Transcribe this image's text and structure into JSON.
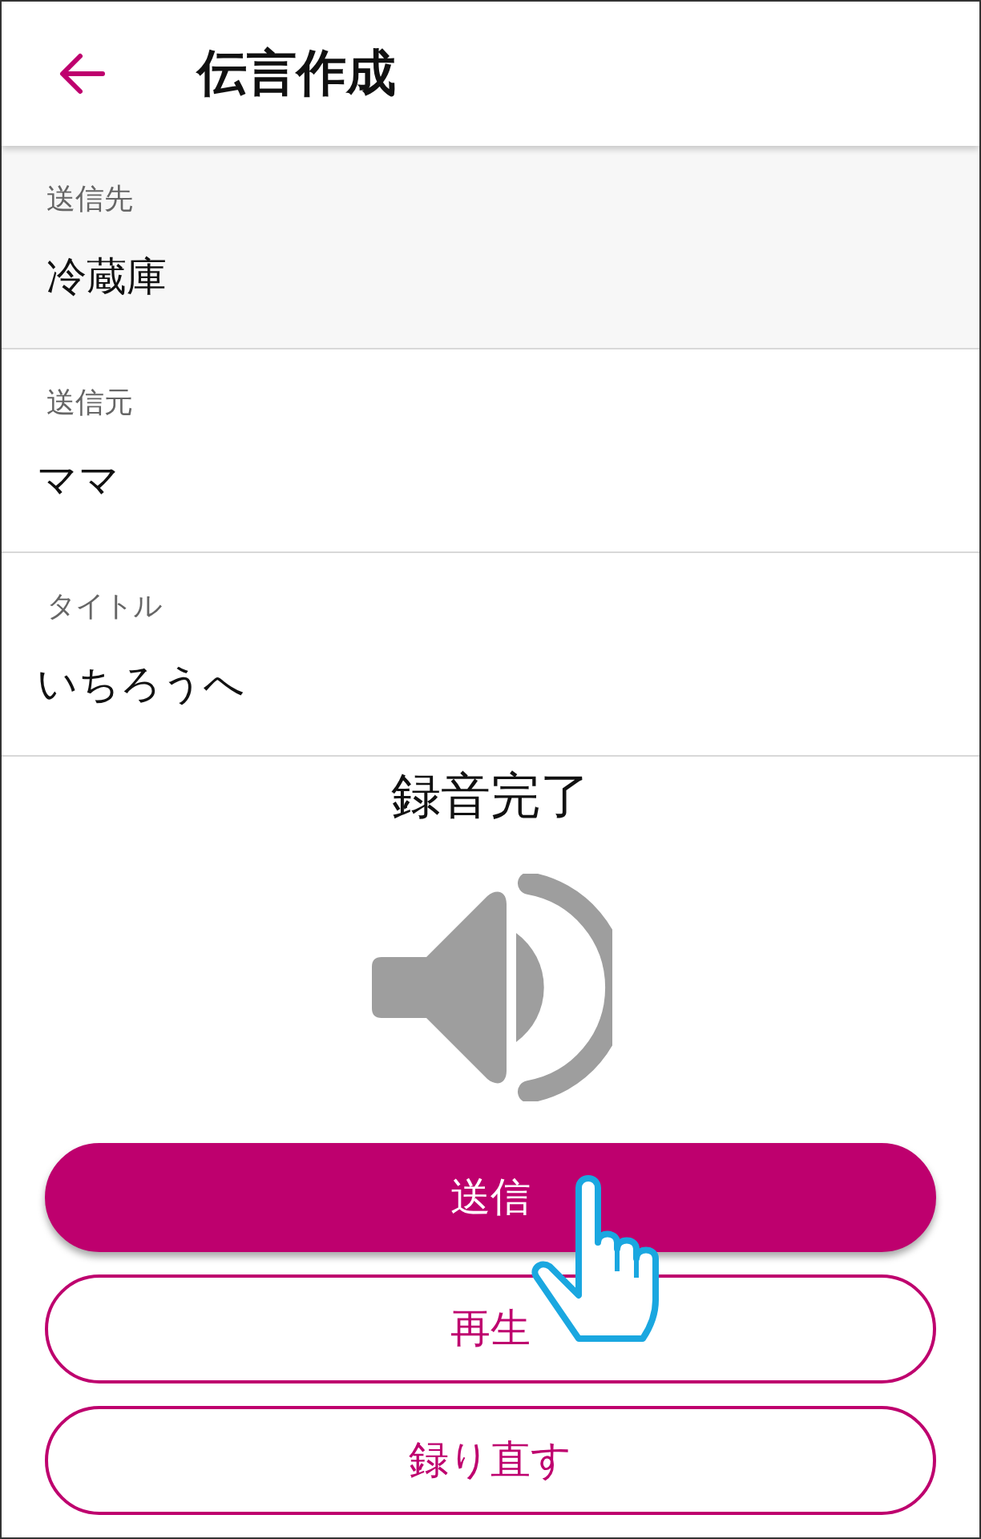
{
  "header": {
    "title": "伝言作成"
  },
  "fields": [
    {
      "label": "送信先",
      "value": "冷蔵庫",
      "selected": true
    },
    {
      "label": "送信元",
      "value": "ママ",
      "selected": false
    },
    {
      "label": "タイトル",
      "value": "いちろうへ",
      "selected": false
    }
  ],
  "status": "録音完了",
  "buttons": [
    {
      "label": "送信",
      "kind": "primary"
    },
    {
      "label": "再生",
      "kind": "outline"
    },
    {
      "label": "録り直す",
      "kind": "outline"
    }
  ]
}
